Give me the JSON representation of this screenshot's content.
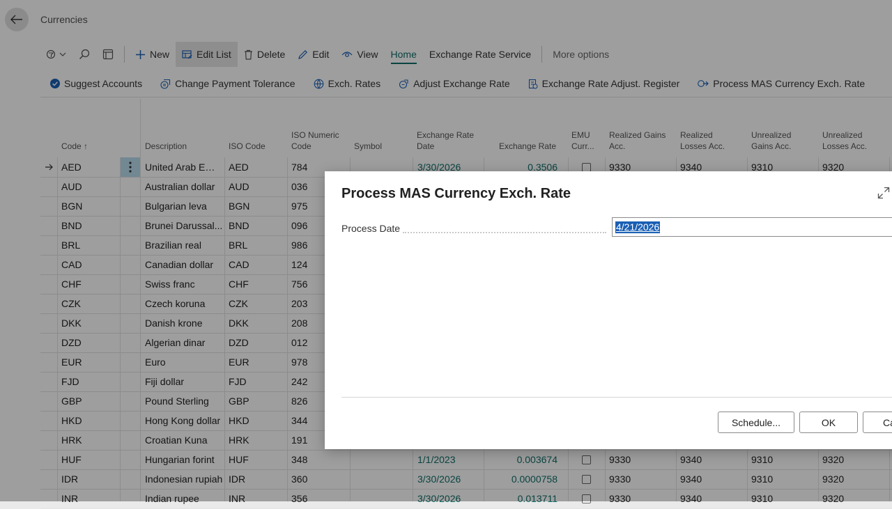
{
  "page": {
    "title": "Currencies"
  },
  "actionbar": {
    "items": [
      {
        "label": "New"
      },
      {
        "label": "Edit List"
      },
      {
        "label": "Delete"
      },
      {
        "label": "Edit"
      },
      {
        "label": "View"
      },
      {
        "label": "Home"
      },
      {
        "label": "Exchange Rate Service"
      },
      {
        "label": "More options"
      }
    ]
  },
  "subactions": [
    {
      "label": "Suggest Accounts"
    },
    {
      "label": "Change Payment Tolerance"
    },
    {
      "label": "Exch. Rates"
    },
    {
      "label": "Adjust Exchange Rate"
    },
    {
      "label": "Exchange Rate Adjust. Register"
    },
    {
      "label": "Process MAS Currency Exch. Rate"
    }
  ],
  "table": {
    "headers": {
      "code": "Code",
      "code_sort": "↑",
      "description": "Description",
      "iso_code": "ISO Code",
      "iso_numeric_1": "ISO Numeric",
      "iso_numeric_2": "Code",
      "symbol": "Symbol",
      "exch_date_1": "Exchange Rate",
      "exch_date_2": "Date",
      "exch_rate": "Exchange Rate",
      "emu_1": "EMU",
      "emu_2": "Curr...",
      "rg_1": "Realized Gains",
      "rg_2": "Acc.",
      "rl_1": "Realized",
      "rl_2": "Losses Acc.",
      "ug_1": "Unrealized",
      "ug_2": "Gains Acc.",
      "ul_1": "Unrealized",
      "ul_2": "Losses Acc."
    },
    "rows": [
      {
        "code": "AED",
        "description": "United Arab Emi...",
        "iso": "AED",
        "num": "784",
        "date": "3/30/2026",
        "rate": "0.3506",
        "rg": "9330",
        "rl": "9340",
        "ug": "9310",
        "ul": "9320"
      },
      {
        "code": "AUD",
        "description": "Australian dollar",
        "iso": "AUD",
        "num": "036",
        "date": "",
        "rate": "",
        "rg": "",
        "rl": "",
        "ug": "",
        "ul": ""
      },
      {
        "code": "BGN",
        "description": "Bulgarian leva",
        "iso": "BGN",
        "num": "975",
        "date": "",
        "rate": "",
        "rg": "",
        "rl": "",
        "ug": "",
        "ul": ""
      },
      {
        "code": "BND",
        "description": "Brunei Darussal...",
        "iso": "BND",
        "num": "096",
        "date": "",
        "rate": "",
        "rg": "",
        "rl": "",
        "ug": "",
        "ul": ""
      },
      {
        "code": "BRL",
        "description": "Brazilian real",
        "iso": "BRL",
        "num": "986",
        "date": "",
        "rate": "",
        "rg": "",
        "rl": "",
        "ug": "",
        "ul": ""
      },
      {
        "code": "CAD",
        "description": "Canadian dollar",
        "iso": "CAD",
        "num": "124",
        "date": "",
        "rate": "",
        "rg": "",
        "rl": "",
        "ug": "",
        "ul": ""
      },
      {
        "code": "CHF",
        "description": "Swiss franc",
        "iso": "CHF",
        "num": "756",
        "date": "",
        "rate": "",
        "rg": "",
        "rl": "",
        "ug": "",
        "ul": ""
      },
      {
        "code": "CZK",
        "description": "Czech koruna",
        "iso": "CZK",
        "num": "203",
        "date": "",
        "rate": "",
        "rg": "",
        "rl": "",
        "ug": "",
        "ul": ""
      },
      {
        "code": "DKK",
        "description": "Danish krone",
        "iso": "DKK",
        "num": "208",
        "date": "",
        "rate": "",
        "rg": "",
        "rl": "",
        "ug": "",
        "ul": ""
      },
      {
        "code": "DZD",
        "description": "Algerian dinar",
        "iso": "DZD",
        "num": "012",
        "date": "",
        "rate": "",
        "rg": "",
        "rl": "",
        "ug": "",
        "ul": ""
      },
      {
        "code": "EUR",
        "description": "Euro",
        "iso": "EUR",
        "num": "978",
        "date": "",
        "rate": "",
        "rg": "",
        "rl": "",
        "ug": "",
        "ul": ""
      },
      {
        "code": "FJD",
        "description": "Fiji dollar",
        "iso": "FJD",
        "num": "242",
        "date": "",
        "rate": "",
        "rg": "",
        "rl": "",
        "ug": "",
        "ul": ""
      },
      {
        "code": "GBP",
        "description": "Pound Sterling",
        "iso": "GBP",
        "num": "826",
        "date": "",
        "rate": "",
        "rg": "",
        "rl": "",
        "ug": "",
        "ul": ""
      },
      {
        "code": "HKD",
        "description": "Hong Kong dollar",
        "iso": "HKD",
        "num": "344",
        "date": "",
        "rate": "",
        "rg": "",
        "rl": "",
        "ug": "",
        "ul": ""
      },
      {
        "code": "HRK",
        "description": "Croatian Kuna",
        "iso": "HRK",
        "num": "191",
        "date": "",
        "rate": "",
        "rg": "",
        "rl": "",
        "ug": "",
        "ul": ""
      },
      {
        "code": "HUF",
        "description": "Hungarian forint",
        "iso": "HUF",
        "num": "348",
        "date": "1/1/2023",
        "rate": "0.003674",
        "rg": "9330",
        "rl": "9340",
        "ug": "9310",
        "ul": "9320"
      },
      {
        "code": "IDR",
        "description": "Indonesian rupiah",
        "iso": "IDR",
        "num": "360",
        "date": "3/30/2026",
        "rate": "0.0000758",
        "rg": "9330",
        "rl": "9340",
        "ug": "9310",
        "ul": "9320"
      },
      {
        "code": "INR",
        "description": "Indian rupee",
        "iso": "INR",
        "num": "356",
        "date": "3/30/2026",
        "rate": "0.013711",
        "rg": "9330",
        "rl": "9340",
        "ug": "9310",
        "ul": "9320"
      }
    ]
  },
  "dialog": {
    "title": "Process MAS Currency Exch. Rate",
    "field_label": "Process Date",
    "field_value": "4/21/2026",
    "schedule_label": "Schedule...",
    "ok_label": "OK",
    "cancel_label": "Can"
  },
  "colors": {
    "accent": "#0f6f6a",
    "selection": "#1a5fb4"
  }
}
